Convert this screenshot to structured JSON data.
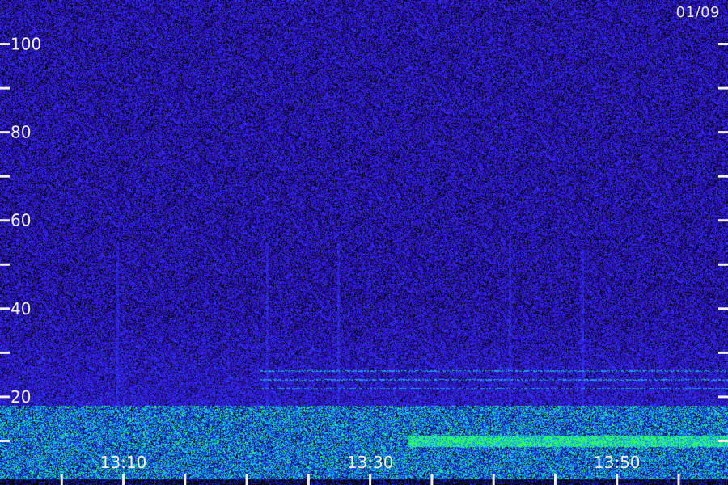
{
  "date_label": "01/09",
  "chart_data": {
    "type": "heatmap",
    "title": "",
    "xlabel": "",
    "ylabel": "",
    "x_tick_labels": [
      "13:10",
      "13:30",
      "13:50"
    ],
    "x_range": [
      "13:00",
      "13:59"
    ],
    "ylim": [
      0,
      110
    ],
    "y_tick_labels": [
      100,
      80,
      60,
      40,
      20
    ],
    "y_minor_ticks": [
      10,
      30,
      50,
      70,
      90
    ],
    "colormap": [
      "#000000",
      "#1a0a5c",
      "#3a1fd0",
      "#1e6cff",
      "#19d6e6",
      "#2cff5a"
    ],
    "features": {
      "low_band_upper": 18,
      "green_band_level": 10,
      "green_band_start": "13:33",
      "cyan_lines_level": [
        22,
        24,
        26
      ],
      "cyan_lines_start": "13:21"
    }
  }
}
